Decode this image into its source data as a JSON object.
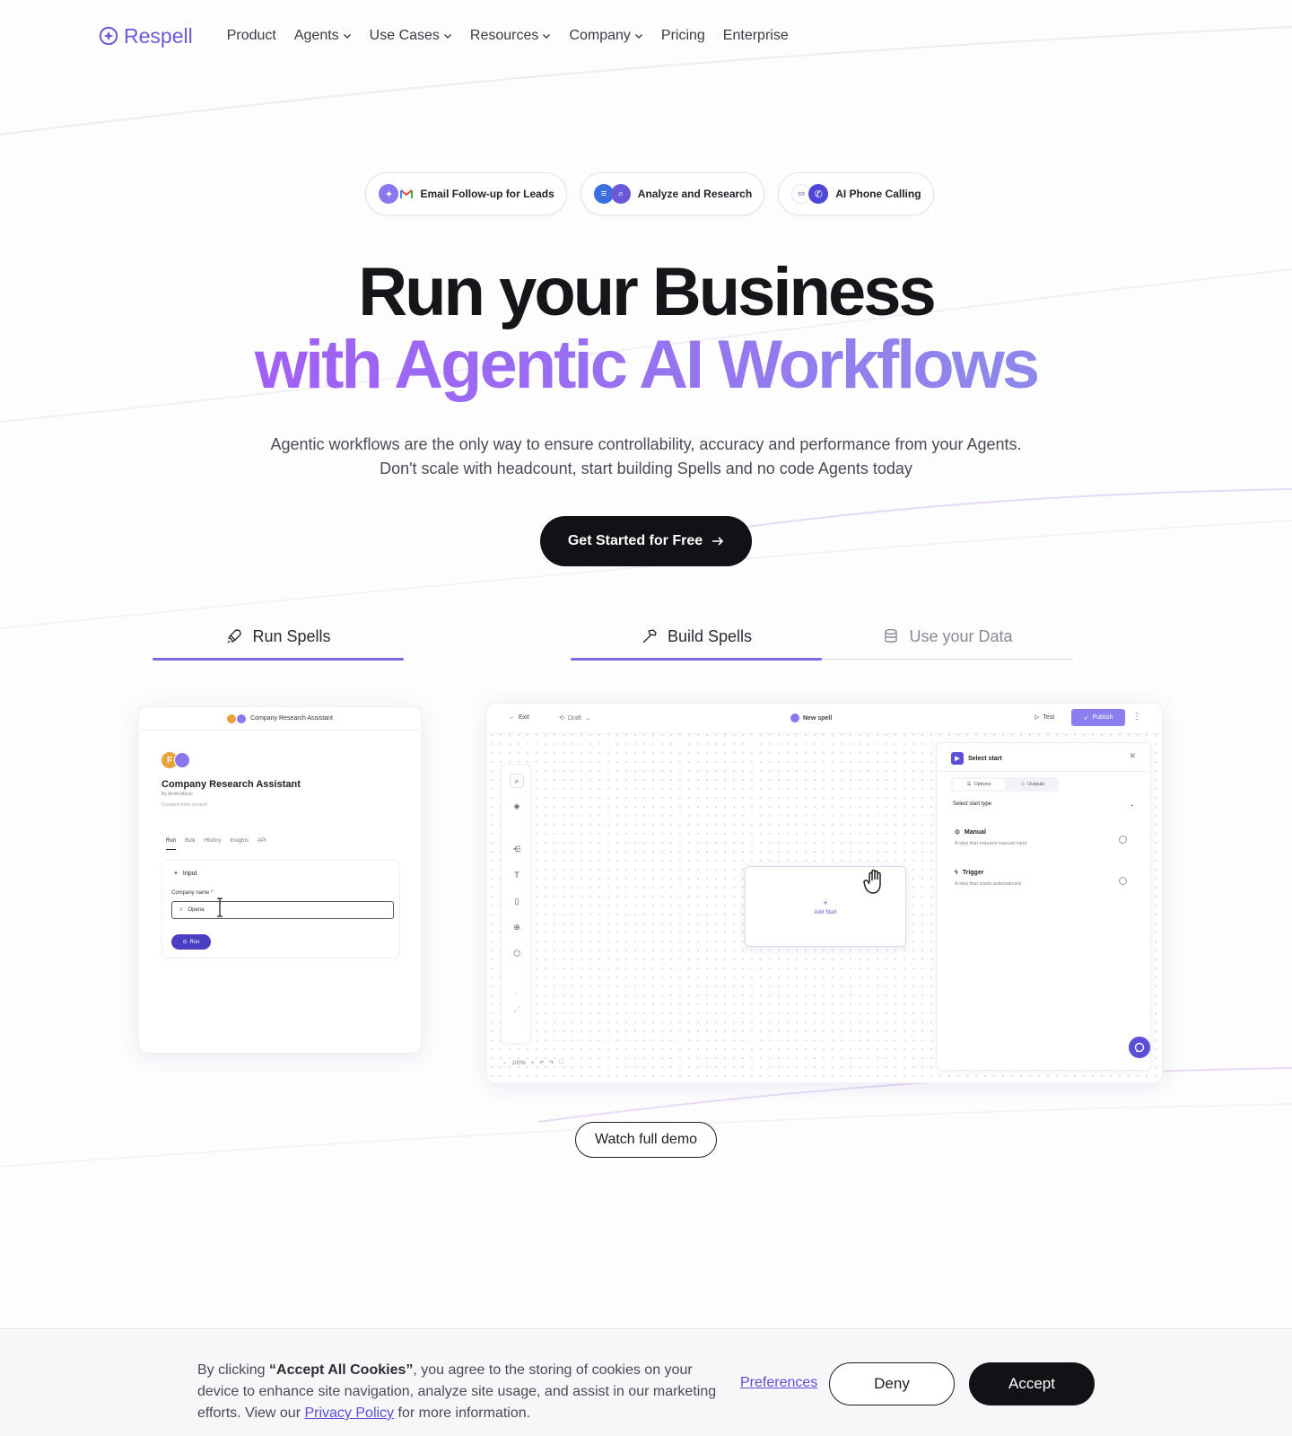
{
  "nav": {
    "logo": "Respell",
    "items": [
      {
        "label": "Product",
        "dropdown": false
      },
      {
        "label": "Agents",
        "dropdown": true
      },
      {
        "label": "Use Cases",
        "dropdown": true
      },
      {
        "label": "Resources",
        "dropdown": true
      },
      {
        "label": "Company",
        "dropdown": true
      },
      {
        "label": "Pricing",
        "dropdown": false
      },
      {
        "label": "Enterprise",
        "dropdown": false
      }
    ]
  },
  "pills": [
    {
      "label": "Email Follow-up for Leads",
      "icons": [
        "spell-icon",
        "gmail-icon"
      ]
    },
    {
      "label": "Analyze and Research",
      "icons": [
        "research-icon",
        "search-icon"
      ]
    },
    {
      "label": "AI Phone Calling",
      "icons": [
        "link-icon",
        "phone-icon"
      ]
    }
  ],
  "hero": {
    "title_line1": "Run your Business",
    "title_line2": "with Agentic AI Workflows",
    "subtitle_line1": "Agentic workflows are the only way to ensure controllability, accuracy and performance from your Agents.",
    "subtitle_line2": "Don't scale with headcount, start building Spells and no code Agents today",
    "cta": "Get Started for Free"
  },
  "tabs": [
    {
      "label": "Run Spells",
      "icon": "rocket-icon",
      "active": true
    },
    {
      "label": "Build Spells",
      "icon": "hammer-icon",
      "active": true
    },
    {
      "label": "Use your Data",
      "icon": "database-icon",
      "active": false
    }
  ],
  "run_card": {
    "header": "Company Research Assistant",
    "avatar_letter": "F",
    "title": "Company Research Assistant",
    "by": "By Andrii Masur",
    "created": "Created from scratch",
    "tabs": [
      "Run",
      "Bulk",
      "History",
      "Insights",
      "API"
    ],
    "input_title": "Input",
    "field_label": "Company name *",
    "field_value": "Opena",
    "run_label": "Run"
  },
  "canvas": {
    "exit": "Exit",
    "draft": "Draft",
    "title": "New spell",
    "test": "Test",
    "publish": "Publish",
    "zoom": "100%",
    "add_start": "Add Start",
    "panel": {
      "title": "Select start",
      "seg": [
        "Options",
        "Outputs"
      ],
      "select_label": "Select start type",
      "options": [
        {
          "title": "Manual",
          "desc": "A step that requires manual input"
        },
        {
          "title": "Trigger",
          "desc": "A step that starts automatically"
        }
      ]
    }
  },
  "demo_button": "Watch full demo",
  "cookie": {
    "text_prefix": "By clicking ",
    "text_bold": "“Accept All Cookies”",
    "text_mid": ", you agree to the storing of cookies on your device to enhance site navigation, analyze site usage, and assist in our marketing efforts. View our ",
    "privacy_link": "Privacy Policy",
    "text_suffix": " for more information.",
    "preferences": "Preferences",
    "deny": "Deny",
    "accept": "Accept"
  },
  "colors": {
    "brand": "#6a5ad8",
    "gradient_start": "#a855f7",
    "gradient_end": "#8a8ae6",
    "dark": "#121216"
  }
}
